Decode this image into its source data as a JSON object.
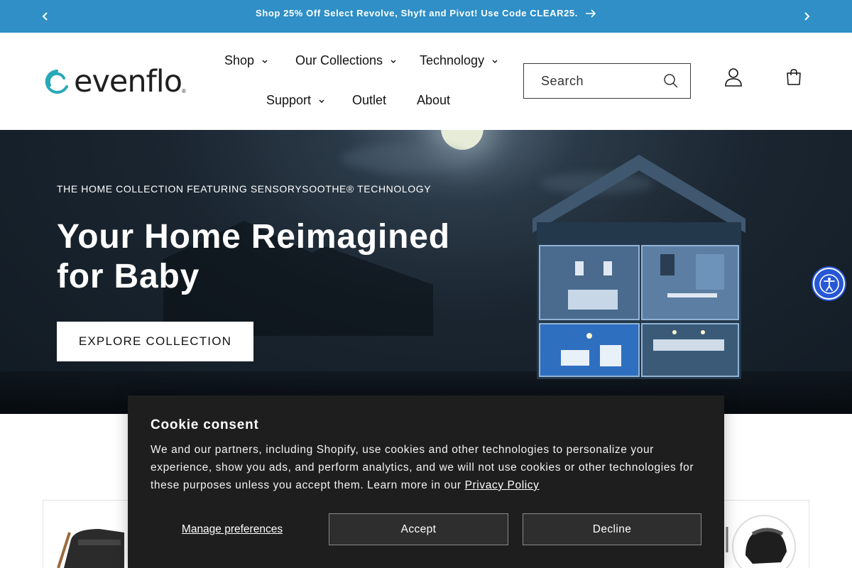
{
  "announcement": {
    "message": "Shop 25% Off Select Revolve, Shyft and Pivot! Use Code CLEAR25.",
    "bg_color": "#2f8fc6"
  },
  "header": {
    "logo_text": "evenflo",
    "logo_reg": "®",
    "nav": [
      {
        "label": "Shop",
        "has_dropdown": true
      },
      {
        "label": "Our Collections",
        "has_dropdown": true
      },
      {
        "label": "Technology",
        "has_dropdown": true
      },
      {
        "label": "Support",
        "has_dropdown": true
      },
      {
        "label": "Outlet",
        "has_dropdown": false
      },
      {
        "label": "About",
        "has_dropdown": false
      }
    ],
    "search_placeholder": "Search",
    "icons": [
      "search-icon",
      "account-icon",
      "cart-icon"
    ]
  },
  "hero": {
    "eyebrow": "THE HOME COLLECTION FEATURING SENSORYSOOTHE® TECHNOLOGY",
    "title": "Your Home Reimagined for Baby",
    "cta_label": "EXPLORE COLLECTION"
  },
  "cookie": {
    "title": "Cookie consent",
    "body": "We and our partners, including Shopify, use cookies and other technologies to personalize your experience, show you ads, and perform analytics, and we will not use cookies or other technologies for these purposes unless you accept them. Learn more in our ",
    "link_label": "Privacy Policy",
    "manage_label": "Manage preferences",
    "accept_label": "Accept",
    "decline_label": "Decline"
  },
  "accessibility": {
    "icon": "accessibility-icon",
    "color": "#2757d6"
  }
}
